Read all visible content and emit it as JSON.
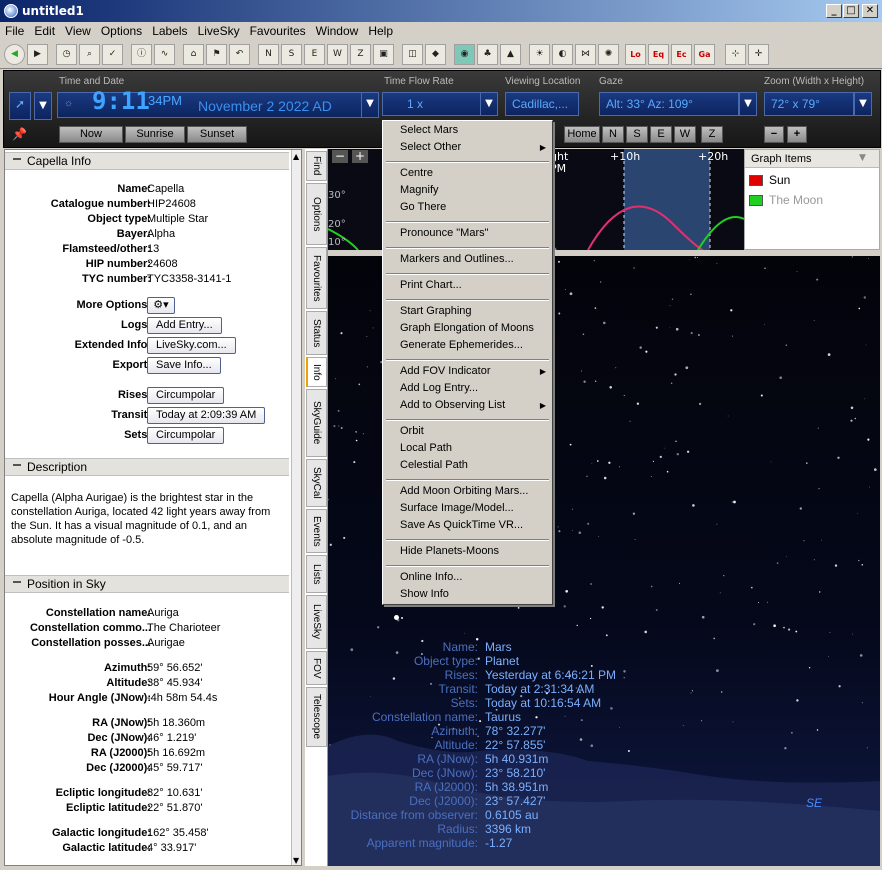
{
  "window": {
    "title": "untitled1"
  },
  "menubar": [
    "File",
    "Edit",
    "View",
    "Options",
    "Labels",
    "LiveSky",
    "Favourites",
    "Window",
    "Help"
  ],
  "controls": {
    "time_date_label": "Time and Date",
    "time": "9:11",
    "ampm": "34PM",
    "date": "November  2  2022 AD",
    "now_btn": "Now",
    "sunrise_btn": "Sunrise",
    "sunset_btn": "Sunset",
    "flow_label": "Time Flow Rate",
    "flow_value": "1 x",
    "location_label": "Viewing Location",
    "location_value": "Cadillac,...",
    "gaze_label": "Gaze",
    "gaze_value": "Alt: 33° Az: 109°",
    "home_btn": "Home",
    "dirs": [
      "N",
      "S",
      "E",
      "W",
      "Z"
    ],
    "zoom_label": "Zoom (Width x Height)",
    "zoom_value": "72° x 79°",
    "zoom_minus": "−",
    "zoom_plus": "+"
  },
  "info_panel": {
    "header": "Capella Info",
    "fields": [
      {
        "label": "Name:",
        "value": "Capella"
      },
      {
        "label": "Catalogue number:",
        "value": "HIP24608"
      },
      {
        "label": "Object type:",
        "value": "Multiple Star"
      },
      {
        "label": "Bayer:",
        "value": "Alpha"
      },
      {
        "label": "Flamsteed/other:",
        "value": "13"
      },
      {
        "label": "HIP number:",
        "value": "24608"
      },
      {
        "label": "TYC number:",
        "value": "TYC3358-3141-1"
      }
    ],
    "more_options_label": "More Options:",
    "logs_label": "Logs:",
    "logs_btn": "Add Entry...",
    "extended_label": "Extended Info:",
    "extended_btn": "LiveSky.com...",
    "export_label": "Export:",
    "export_btn": "Save Info...",
    "rises_label": "Rises:",
    "rises_btn": "Circumpolar",
    "transit_label": "Transit:",
    "transit_btn": "Today at 2:09:39 AM",
    "sets_label": "Sets:",
    "sets_btn": "Circumpolar",
    "desc_header": "Description",
    "description": "Capella (Alpha Aurigae) is the brightest star in the constellation Auriga, located 42 light years away from the Sun.  It has a visual magnitude of 0.1, and an absolute magnitude of -0.5.",
    "pos_header": "Position in Sky",
    "pos_group1": [
      {
        "label": "Constellation name:",
        "value": "Auriga"
      },
      {
        "label": "Constellation commo...",
        "value": "The Charioteer"
      },
      {
        "label": "Constellation posses...",
        "value": "Aurigae"
      }
    ],
    "pos_group2": [
      {
        "label": "Azimuth:",
        "value": "59° 56.652'"
      },
      {
        "label": "Altitude:",
        "value": "38° 45.934'"
      },
      {
        "label": "Hour Angle (JNow):",
        "value": "-4h 58m 54.4s"
      }
    ],
    "pos_group3": [
      {
        "label": "RA (JNow):",
        "value": "5h 18.360m"
      },
      {
        "label": "Dec (JNow):",
        "value": "46° 1.219'"
      },
      {
        "label": "RA (J2000):",
        "value": "5h 16.692m"
      },
      {
        "label": "Dec (J2000):",
        "value": "45° 59.717'"
      }
    ],
    "pos_group4": [
      {
        "label": "Ecliptic longitude:",
        "value": "82° 10.631'"
      },
      {
        "label": "Ecliptic latitude:",
        "value": "22° 51.870'"
      }
    ],
    "pos_group5": [
      {
        "label": "Galactic longitude:",
        "value": "162° 35.458'"
      },
      {
        "label": "Galactic latitude:",
        "value": "4° 33.917'"
      }
    ]
  },
  "side_tabs": [
    "Find",
    "Options",
    "Favourites",
    "Status",
    "Info",
    "SkyGuide",
    "SkyCal",
    "Events",
    "Lists",
    "LiveSky",
    "FOV",
    "Telescope"
  ],
  "graph": {
    "ticks": [
      "ght",
      "+10h",
      "+20h"
    ],
    "pm_label": "PM",
    "y_ticks": [
      "30°",
      "20°",
      "10°"
    ],
    "items_header": "Graph Items",
    "items": [
      {
        "name": "Sun",
        "color": "#e00000"
      },
      {
        "name": "The Moon",
        "color": "#20d020"
      }
    ]
  },
  "sky": {
    "compass": "SE",
    "object_info": [
      {
        "label": "Name:",
        "value": "Mars"
      },
      {
        "label": "Object type:",
        "value": "Planet"
      },
      {
        "label": "Rises:",
        "value": "Yesterday at 6:46:21 PM"
      },
      {
        "label": "Transit:",
        "value": "Today at 2:31:34 AM"
      },
      {
        "label": "Sets:",
        "value": "Today at 10:16:54 AM"
      },
      {
        "label": "Constellation name:",
        "value": "Taurus"
      },
      {
        "label": "Azimuth:",
        "value": "78° 32.277'"
      },
      {
        "label": "Altitude:",
        "value": "22° 57.855'"
      },
      {
        "label": "RA (JNow):",
        "value": "5h 40.931m"
      },
      {
        "label": "Dec (JNow):",
        "value": "23° 58.210'"
      },
      {
        "label": "RA (J2000):",
        "value": "5h 38.951m"
      },
      {
        "label": "Dec (J2000):",
        "value": "23° 57.427'"
      },
      {
        "label": "Distance from observer:",
        "value": "0.6105 au"
      },
      {
        "label": "Radius:",
        "value": "3396 km"
      },
      {
        "label": "Apparent magnitude:",
        "value": "-1.27"
      }
    ]
  },
  "context_menu": {
    "groups": [
      [
        {
          "label": "Select Mars"
        },
        {
          "label": "Select Other",
          "submenu": true
        }
      ],
      [
        {
          "label": "Centre"
        },
        {
          "label": "Magnify"
        },
        {
          "label": "Go There"
        }
      ],
      [
        {
          "label": "Pronounce \"Mars\""
        }
      ],
      [
        {
          "label": "Markers and Outlines..."
        }
      ],
      [
        {
          "label": "Print Chart..."
        }
      ],
      [
        {
          "label": "Start Graphing"
        },
        {
          "label": "Graph Elongation of Moons"
        },
        {
          "label": "Generate Ephemerides..."
        }
      ],
      [
        {
          "label": "Add FOV Indicator",
          "submenu": true
        },
        {
          "label": "Add Log Entry..."
        },
        {
          "label": "Add to Observing List",
          "submenu": true
        }
      ],
      [
        {
          "label": "Orbit"
        },
        {
          "label": "Local Path"
        },
        {
          "label": "Celestial Path"
        }
      ],
      [
        {
          "label": "Add Moon Orbiting Mars..."
        },
        {
          "label": "Surface Image/Model..."
        },
        {
          "label": "Save As QuickTime VR..."
        }
      ],
      [
        {
          "label": "Hide Planets-Moons"
        }
      ],
      [
        {
          "label": "Online Info..."
        },
        {
          "label": "Show Info"
        }
      ]
    ]
  },
  "toolbar_labels": [
    "Lo",
    "Eq",
    "Ec",
    "Ga"
  ]
}
